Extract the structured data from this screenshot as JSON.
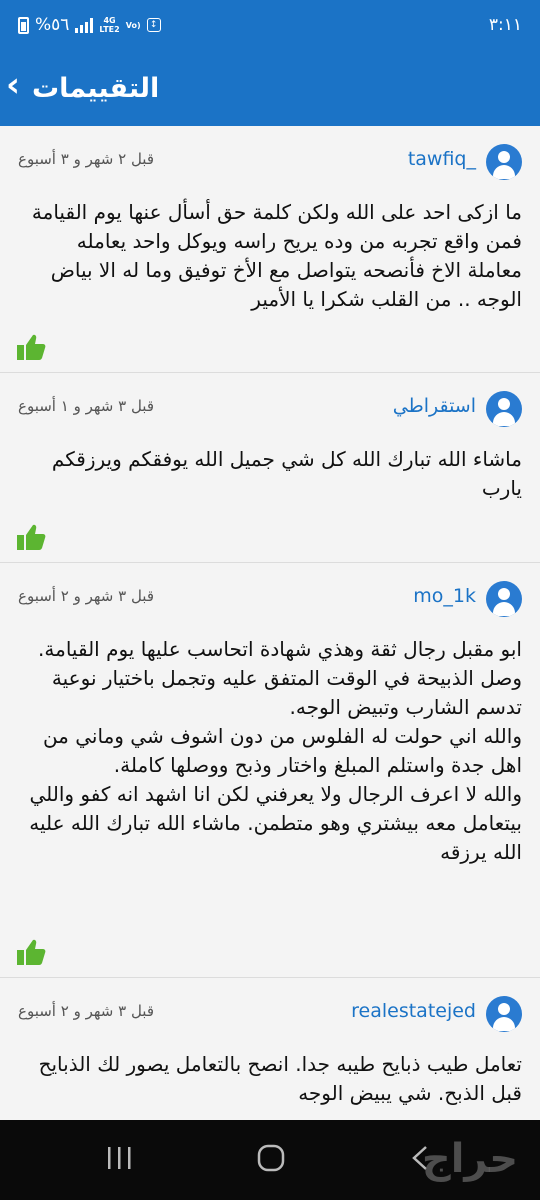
{
  "status_bar": {
    "time": "٣:١١",
    "battery": "%٥٦",
    "network_top": "4G",
    "network_bottom": "LTE2",
    "volte_label": "Vo)"
  },
  "app_bar": {
    "title": "التقييمات",
    "back_icon": "chevron-left-icon"
  },
  "colors": {
    "brand_blue": "#1b73c6",
    "like_green": "#5cb531",
    "background": "#f4f4f4"
  },
  "reviews": [
    {
      "username": "tawfiq_",
      "time": "قبل ٢ شهر و ٣ أسبوع",
      "text": "ما ازكى احد على الله ولكن كلمة حق أسأل عنها يوم القيامة  فمن واقع تجربه من وده يريح راسه ويوكل واحد يعامله معاملة الاخ فأنصحه يتواصل مع الأخ توفيق وما له الا بياض الوجه .. من القلب شكرا يا الأمير"
    },
    {
      "username": "استقراطي",
      "time": "قبل ٣ شهر و ١ أسبوع",
      "text": "ماشاء الله تبارك الله كل شي جميل الله يوفقكم ويرزقكم يارب"
    },
    {
      "username": "mo_1k",
      "time": "قبل ٣ شهر و ٢ أسبوع",
      "text": "ابو مقبل رجال ثقة وهذي شهادة اتحاسب عليها يوم القيامة.\nوصل الذبيحة في الوقت المتفق عليه وتجمل باختيار نوعية تدسم الشارب وتبيض الوجه.\nوالله اني حولت له الفلوس من دون اشوف شي وماني من اهل جدة واستلم المبلغ واختار وذبح ووصلها كاملة.\nوالله لا اعرف الرجال ولا يعرفني لكن انا اشهد انه كفو واللي بيتعامل معه بيشتري وهو متطمن. ماشاء الله تبارك الله عليه\nالله يرزقه"
    },
    {
      "username": "realestatejed",
      "time": "قبل ٣ شهر و ٢ أسبوع",
      "text": "تعامل طيب  ذبايح طيبه جدا. انصح بالتعامل   يصور لك الذبايح قبل الذبح. شي يبيض الوجه"
    }
  ],
  "nav_bar": {
    "recents_icon": "recents-icon",
    "home_icon": "home-icon",
    "back_icon": "back-triangle-icon",
    "watermark": "حراج"
  }
}
